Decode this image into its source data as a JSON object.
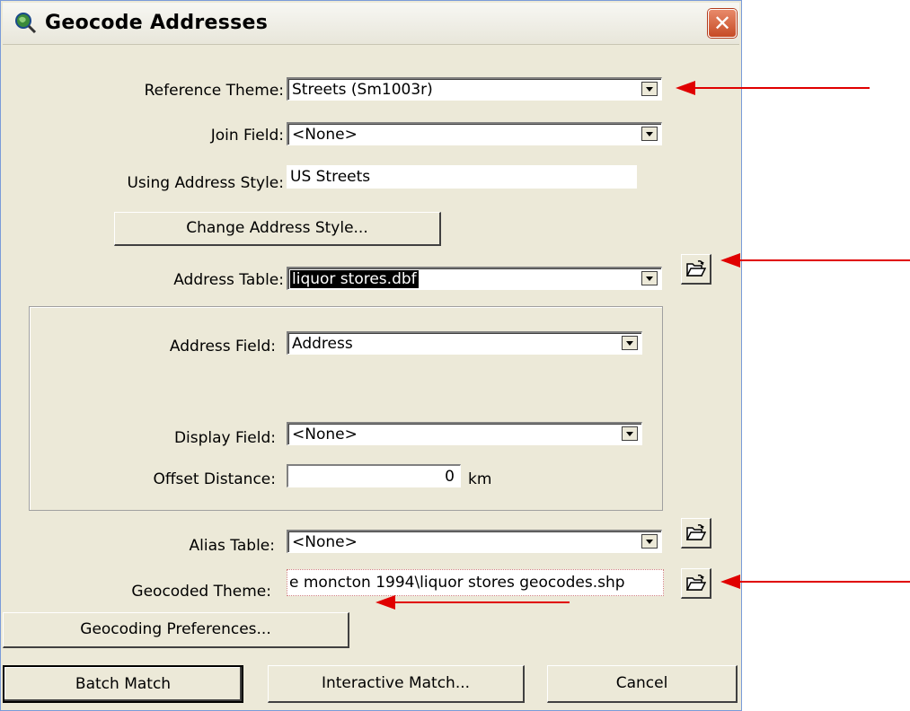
{
  "window": {
    "title": "Geocode Addresses",
    "close_label": "✕"
  },
  "fields": {
    "reference_theme": {
      "label": "Reference Theme:",
      "value": "Streets (Sm1003r)"
    },
    "join_field": {
      "label": "Join Field:",
      "value": "<None>"
    },
    "address_style": {
      "label": "Using Address Style:",
      "value": "US Streets"
    },
    "address_table": {
      "label": "Address Table:",
      "value": "liquor stores.dbf"
    },
    "address_field": {
      "label": "Address Field:",
      "value": "Address"
    },
    "display_field": {
      "label": "Display Field:",
      "value": "<None>"
    },
    "offset_distance": {
      "label": "Offset Distance:",
      "value": "0",
      "unit": "km"
    },
    "alias_table": {
      "label": "Alias Table:",
      "value": "<None>"
    },
    "geocoded_theme": {
      "label": "Geocoded Theme:",
      "value": "e moncton 1994\\liquor stores geocodes.shp"
    }
  },
  "buttons": {
    "change_address_style": "Change Address Style...",
    "geocoding_preferences": "Geocoding Preferences...",
    "batch_match": "Batch Match",
    "interactive_match": "Interactive Match...",
    "cancel": "Cancel"
  },
  "colors": {
    "annotation_arrow": "#e00000",
    "dialog_bg": "#ece9d8"
  }
}
